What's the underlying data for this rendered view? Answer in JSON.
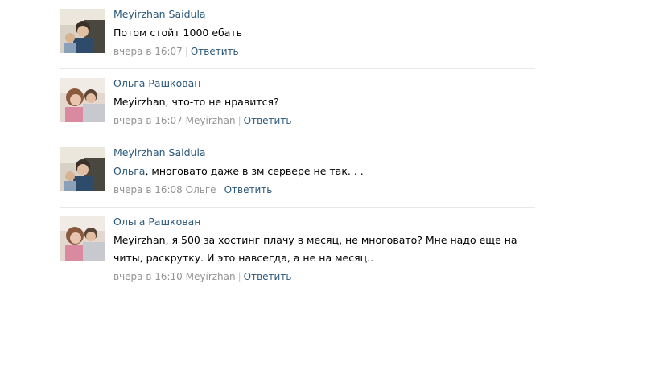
{
  "comments": [
    {
      "author": "Meyirzhan Saidula",
      "avatar": "avatar-meyirzhan",
      "text": "Потом стойт 1000 ебать",
      "time": "вчера в 16:07",
      "separator": "|",
      "reply_label": "Ответить"
    },
    {
      "author": "Ольга Рашкован",
      "avatar": "avatar-olga",
      "text": "Meyirzhan, что-то не нравится?",
      "time": "вчера в 16:07",
      "reply_to": "Meyirzhan",
      "separator": "|",
      "reply_label": "Ответить"
    },
    {
      "author": "Meyirzhan Saidula",
      "avatar": "avatar-meyirzhan",
      "mention": "Ольга",
      "text": ", многовато даже в зм сервере не так. . .",
      "time": "вчера в 16:08",
      "reply_to": "Ольге",
      "separator": "|",
      "reply_label": "Ответить"
    },
    {
      "author": "Ольга Рашкован",
      "avatar": "avatar-olga",
      "text": "Meyirzhan, я 500 за хостинг плачу в месяц, не многовато? Мне надо еще на читы, раскрутку. И это навсегда, а не на месяц..",
      "time": "вчера в 16:10",
      "reply_to": "Meyirzhan",
      "separator": "|",
      "reply_label": "Ответить"
    }
  ],
  "colors": {
    "link": "#2b587a",
    "meta": "#939393",
    "divider": "#e7e8ec"
  }
}
